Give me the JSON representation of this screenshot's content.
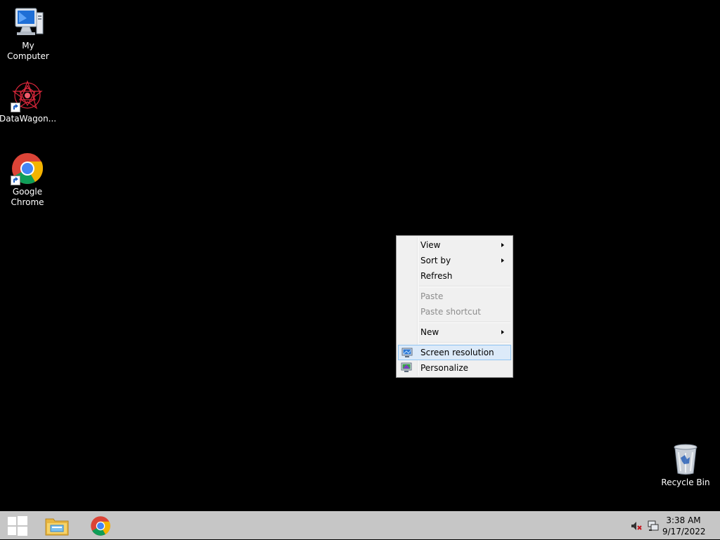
{
  "desktop": {
    "icons": [
      {
        "label": "My Computer",
        "icon": "computer-icon"
      },
      {
        "label": "DataWagon...",
        "icon": "datawagon-icon"
      },
      {
        "label_line1": "Google",
        "label_line2": "Chrome",
        "icon": "chrome-icon"
      },
      {
        "label": "Recycle Bin",
        "icon": "recycle-bin-icon"
      }
    ]
  },
  "context_menu": {
    "items": [
      {
        "label": "View",
        "submenu": true,
        "enabled": true
      },
      {
        "label": "Sort by",
        "submenu": true,
        "enabled": true
      },
      {
        "label": "Refresh",
        "submenu": false,
        "enabled": true
      },
      {
        "label": "Paste",
        "submenu": false,
        "enabled": false
      },
      {
        "label": "Paste shortcut",
        "submenu": false,
        "enabled": false
      },
      {
        "label": "New",
        "submenu": true,
        "enabled": true
      },
      {
        "label": "Screen resolution",
        "submenu": false,
        "enabled": true,
        "highlighted": true,
        "icon": "screen-resolution-icon"
      },
      {
        "label": "Personalize",
        "submenu": false,
        "enabled": true,
        "icon": "personalize-icon"
      }
    ]
  },
  "taskbar": {
    "pinned": [
      "start-button",
      "file-explorer-icon",
      "chrome-icon"
    ],
    "tray": [
      "volume-muted-icon",
      "network-icon"
    ],
    "clock": {
      "time": "3:38 AM",
      "date": "9/17/2022"
    }
  },
  "colors": {
    "desktop_bg": "#000000",
    "taskbar_bg": "#c6c6c6",
    "menu_bg": "#f0f0f0",
    "highlight_bg": "#dceaf9",
    "highlight_border": "#90c4f2",
    "disabled_text": "#8d8d8d"
  }
}
